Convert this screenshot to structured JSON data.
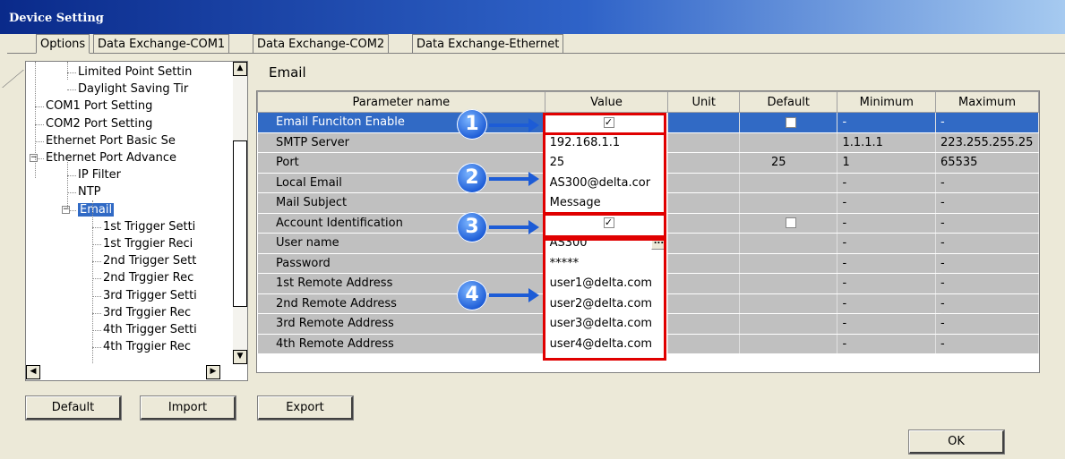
{
  "window": {
    "title": "Device Setting"
  },
  "tabs": [
    {
      "label": "Options",
      "active": true
    },
    {
      "label": "Data Exchange-COM1",
      "active": false
    },
    {
      "label": "Data Exchange-COM2",
      "active": false
    },
    {
      "label": "Data Exchange-Ethernet",
      "active": false
    }
  ],
  "tree": {
    "items": [
      {
        "label": "Limited Point Settin",
        "level": 2,
        "selected": false
      },
      {
        "label": "Daylight Saving Tir",
        "level": 2,
        "selected": false
      },
      {
        "label": "COM1 Port Setting",
        "level": 1,
        "selected": false
      },
      {
        "label": "COM2 Port Setting",
        "level": 1,
        "selected": false
      },
      {
        "label": "Ethernet Port Basic Se",
        "level": 1,
        "selected": false
      },
      {
        "label": "Ethernet Port Advance",
        "level": 1,
        "selected": false,
        "expander": "−"
      },
      {
        "label": "IP Filter",
        "level": 2,
        "selected": false
      },
      {
        "label": "NTP",
        "level": 2,
        "selected": false
      },
      {
        "label": "Email",
        "level": 2,
        "selected": true,
        "expander": "−"
      },
      {
        "label": "1st Trigger Setti",
        "level": 3,
        "selected": false
      },
      {
        "label": "1st Trggier Reci",
        "level": 3,
        "selected": false
      },
      {
        "label": "2nd Trigger Sett",
        "level": 3,
        "selected": false
      },
      {
        "label": "2nd Trggier Rec",
        "level": 3,
        "selected": false
      },
      {
        "label": "3rd Trigger Setti",
        "level": 3,
        "selected": false
      },
      {
        "label": "3rd Trggier Rec",
        "level": 3,
        "selected": false
      },
      {
        "label": "4th Trigger Setti",
        "level": 3,
        "selected": false
      },
      {
        "label": "4th Trggier Rec",
        "level": 3,
        "selected": false
      }
    ]
  },
  "panel": {
    "title": "Email"
  },
  "grid": {
    "headers": [
      "Parameter name",
      "Value",
      "Unit",
      "Default",
      "Minimum",
      "Maximum"
    ],
    "rows": [
      {
        "name": "Email Funciton Enable",
        "value": "",
        "value_type": "checkbox",
        "checked": true,
        "unit": "",
        "default": "",
        "default_type": "checkbox",
        "min": "-",
        "max": "-",
        "selected": true
      },
      {
        "name": "SMTP Server",
        "value": "192.168.1.1",
        "value_type": "text",
        "unit": "",
        "default": "",
        "min": "1.1.1.1",
        "max": "223.255.255.25"
      },
      {
        "name": "Port",
        "value": "25",
        "value_type": "text",
        "unit": "",
        "default": "25",
        "min": "1",
        "max": "65535"
      },
      {
        "name": "Local Email",
        "value": "AS300@delta.cor",
        "value_type": "text",
        "unit": "",
        "default": "",
        "min": "-",
        "max": "-"
      },
      {
        "name": "Mail Subject",
        "value": "Message",
        "value_type": "text",
        "unit": "",
        "default": "",
        "min": "-",
        "max": "-"
      },
      {
        "name": "Account Identification",
        "value": "",
        "value_type": "checkbox",
        "checked": true,
        "unit": "",
        "default": "",
        "default_type": "checkbox",
        "min": "-",
        "max": "-"
      },
      {
        "name": "User name",
        "value": "AS300",
        "value_type": "text-ellipsis",
        "ellipsis_label": "...",
        "unit": "",
        "default": "",
        "min": "-",
        "max": "-"
      },
      {
        "name": "Password",
        "value": "*****",
        "value_type": "text",
        "unit": "",
        "default": "",
        "min": "-",
        "max": "-"
      },
      {
        "name": "1st Remote Address",
        "value": "user1@delta.com",
        "value_type": "text",
        "unit": "",
        "default": "",
        "min": "-",
        "max": "-"
      },
      {
        "name": "2nd Remote Address",
        "value": "user2@delta.com",
        "value_type": "text",
        "unit": "",
        "default": "",
        "min": "-",
        "max": "-"
      },
      {
        "name": "3rd Remote Address",
        "value": "user3@delta.com",
        "value_type": "text",
        "unit": "",
        "default": "",
        "min": "-",
        "max": "-"
      },
      {
        "name": "4th Remote Address",
        "value": "user4@delta.com",
        "value_type": "text",
        "unit": "",
        "default": "",
        "min": "-",
        "max": "-"
      }
    ]
  },
  "callouts": [
    "1",
    "2",
    "3",
    "4"
  ],
  "buttons": {
    "default": "Default",
    "import": "Import",
    "export": "Export",
    "ok": "OK"
  },
  "colors": {
    "selection": "#316ac5",
    "highlight_box": "#e00000",
    "callout": "#1d5cd6",
    "title_bar": "#0a2a8a"
  }
}
